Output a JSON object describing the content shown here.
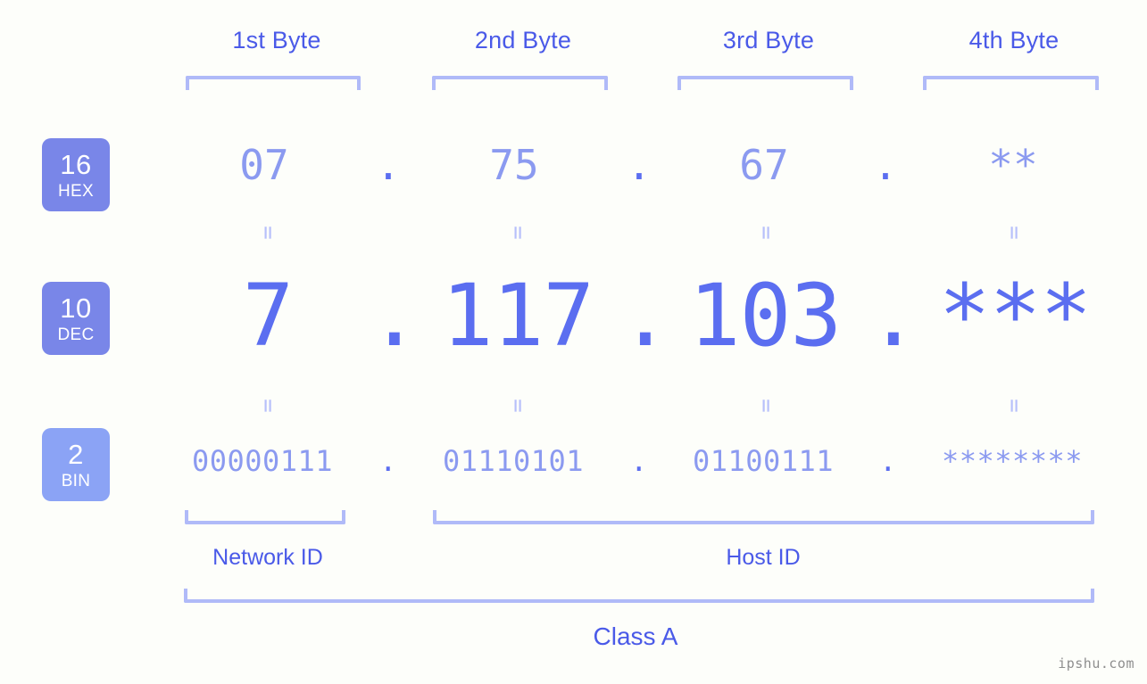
{
  "bytes": [
    {
      "label": "1st Byte"
    },
    {
      "label": "2nd Byte"
    },
    {
      "label": "3rd Byte"
    },
    {
      "label": "4th Byte"
    }
  ],
  "bases": [
    {
      "num": "16",
      "name": "HEX",
      "color": "#7986e8"
    },
    {
      "num": "10",
      "name": "DEC",
      "color": "#7986e8"
    },
    {
      "num": "2",
      "name": "BIN",
      "color": "#8ba3f5"
    }
  ],
  "rows": {
    "hex": {
      "values": [
        "07",
        "75",
        "67",
        "**"
      ],
      "separator": "."
    },
    "dec": {
      "values": [
        "7",
        "117",
        "103",
        "***"
      ],
      "separator": "."
    },
    "bin": {
      "values": [
        "00000111",
        "01110101",
        "01100111",
        "********"
      ],
      "separator": "."
    }
  },
  "equals_glyph": "=",
  "sections": [
    {
      "label": "Network ID"
    },
    {
      "label": "Host ID"
    }
  ],
  "class": {
    "label": "Class A"
  },
  "watermark": {
    "text": "ipshu.com"
  },
  "colors": {
    "background": "#fdfefa",
    "accent_strong": "#5b6ef0",
    "accent_mid": "#4a5ae8",
    "accent_light": "#8b9af0",
    "bracket": "#b0baf8",
    "badge": "#7986e8",
    "badge_bin": "#8ba3f5",
    "watermark": "#8e8e8e"
  }
}
